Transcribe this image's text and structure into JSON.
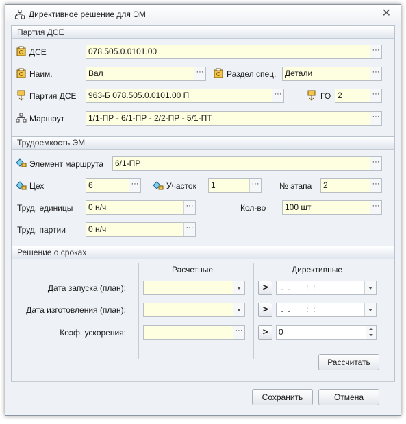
{
  "window": {
    "title": "Директивное решение для ЭМ",
    "close_glyph": "✕"
  },
  "batch": {
    "header": "Партия ДСЕ",
    "dse": {
      "label": "ДСЕ",
      "value": "078.505.0.0101.00"
    },
    "name": {
      "label": "Наим.",
      "value": "Вал"
    },
    "section_spec": {
      "label": "Раздел спец.",
      "value": "Детали"
    },
    "batch_dse": {
      "label": "Партия ДСЕ",
      "value": "963-Б 078.505.0.0101.00 П"
    },
    "go": {
      "label": "ГО",
      "value": "2"
    },
    "route": {
      "label": "Маршрут",
      "value": "1/1-ПР - 6/1-ПР - 2/2-ПР - 5/1-ПТ"
    }
  },
  "labor": {
    "header": "Трудоемкость ЭМ",
    "route_element": {
      "label": "Элемент маршрута",
      "value": "6/1-ПР"
    },
    "workshop": {
      "label": "Цех",
      "value": "6"
    },
    "section": {
      "label": "Участок",
      "value": "1"
    },
    "stage_no": {
      "label": "№ этапа",
      "value": "2"
    },
    "labor_units": {
      "label": "Труд. единицы",
      "value": "0 н/ч"
    },
    "quantity": {
      "label": "Кол-во",
      "value": "100 шт"
    },
    "labor_batch": {
      "label": "Труд. партии",
      "value": "0 н/ч"
    }
  },
  "deadlines": {
    "header": "Решение о сроках",
    "col_calc": "Расчетные",
    "col_directive": "Директивные",
    "launch_date": {
      "label": "Дата запуска (план):",
      "calc": "",
      "directive": " .  .       :  :"
    },
    "make_date": {
      "label": "Дата изготовления (план):",
      "calc": "",
      "directive": " .  .       :  :"
    },
    "accel_coef": {
      "label": "Коэф. ускорения:",
      "calc": "",
      "directive": "0"
    },
    "calc_button": "Рассчитать",
    "arrow_glyph": ">"
  },
  "footer": {
    "save": "Сохранить",
    "cancel": "Отмена"
  },
  "ellipsis": "···",
  "colors": {
    "field_bg": "#fefee0",
    "dialog_bg": "#eef1f5",
    "border": "#b9c2cd"
  }
}
